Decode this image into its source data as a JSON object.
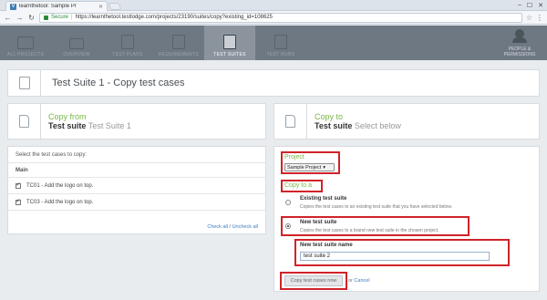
{
  "browser": {
    "tab_title": "learnthetool: Sample Pr",
    "tab_close": "✕",
    "favicon": "V",
    "secure_label": "Secure",
    "url": "https://learnthetool.testlodge.com/projects/23190/suites/copy?existing_id=108625",
    "window_controls": [
      "–",
      "☐",
      "✕"
    ]
  },
  "nav": {
    "items": [
      {
        "label": "ALL PROJECTS",
        "icon": "folder-icon",
        "active": false
      },
      {
        "label": "OVERVIEW",
        "icon": "monitor-icon",
        "active": false
      },
      {
        "label": "TEST PLANS",
        "icon": "test-plans-icon",
        "active": false
      },
      {
        "label": "REQUIREMENTS",
        "icon": "document-icon",
        "active": false
      },
      {
        "label": "TEST SUITES",
        "icon": "clipboard-icon",
        "active": true
      },
      {
        "label": "TEST RUNS",
        "icon": "checkbox-icon",
        "active": false
      }
    ],
    "people_line1": "PEOPLE &",
    "people_line2": "PERMISSIONS"
  },
  "page": {
    "title": "Test Suite 1 - Copy test cases"
  },
  "copy_from": {
    "label": "Copy from",
    "kind": "Test suite",
    "name": "Test Suite 1"
  },
  "copy_to": {
    "label": "Copy to",
    "kind": "Test suite",
    "name": "Select below"
  },
  "test_cases": {
    "instruction": "Select the test cases to copy:",
    "group": "Main",
    "items": [
      {
        "label": "TC01 - Add the logo on top.",
        "checked": true
      },
      {
        "label": "TC03 - Add the logo on top.",
        "checked": true
      }
    ],
    "check_all": "Check all",
    "divider": "/",
    "uncheck_all": "Uncheck all"
  },
  "form": {
    "project_label": "Project",
    "project_value": "Sample Project",
    "copy_to_label": "Copy to a",
    "existing_title": "Existing test suite",
    "existing_desc": "Copies the test cases to an existing test suite that you have selected below.",
    "new_title": "New test suite",
    "new_desc": "Copies the test cases to a brand new test suite in the chosen project.",
    "name_label": "New test suite name",
    "name_value": "test suite 2",
    "submit_label": "Copy test cases now",
    "or_text": "or",
    "cancel_label": "Cancel"
  },
  "colors": {
    "accent_green": "#7ab648",
    "highlight_red": "#d0232a",
    "nav_bg": "#6e7883",
    "link_blue": "#3a7ec2"
  }
}
